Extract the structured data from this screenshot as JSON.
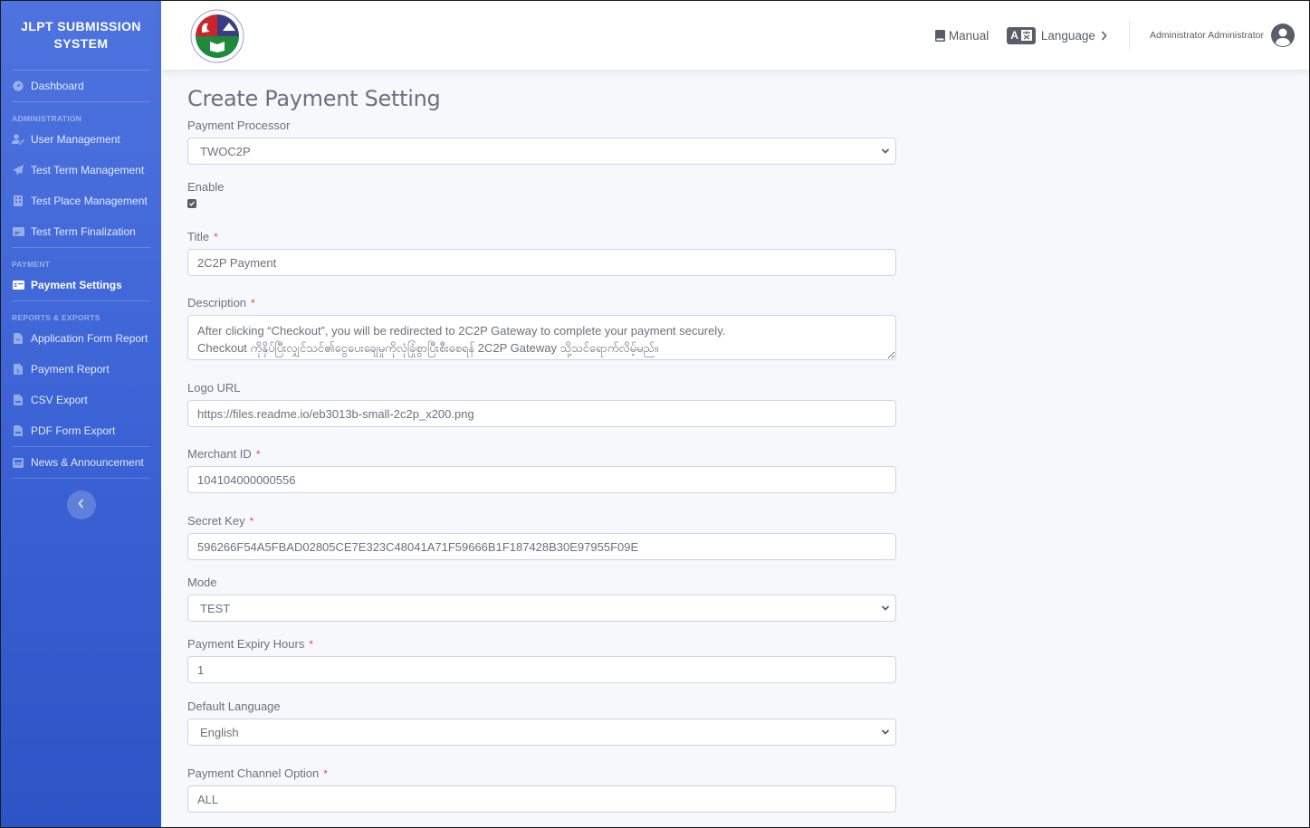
{
  "brand": {
    "line1": "JLPT SUBMISSION",
    "line2": "SYSTEM"
  },
  "sidebar": {
    "dashboard": {
      "label": "Dashboard",
      "icon": "tachometer-icon"
    },
    "sections": [
      {
        "heading": "ADMINISTRATION",
        "items": [
          {
            "label": "User Management",
            "icon": "user-edit-icon"
          },
          {
            "label": "Test Term Management",
            "icon": "paper-plane-icon"
          },
          {
            "label": "Test Place Management",
            "icon": "building-icon"
          },
          {
            "label": "Test Term Finalization",
            "icon": "id-card-icon"
          }
        ]
      },
      {
        "heading": "PAYMENT",
        "items": [
          {
            "label": "Payment Settings",
            "icon": "payment-card-icon",
            "active": true
          }
        ]
      },
      {
        "heading": "REPORTS & EXPORTS",
        "items": [
          {
            "label": "Application Form Report",
            "icon": "file-icon"
          },
          {
            "label": "Payment Report",
            "icon": "file-invoice-dollar-icon"
          },
          {
            "label": "CSV Export",
            "icon": "file-csv-icon"
          },
          {
            "label": "PDF Form Export",
            "icon": "file-pdf-icon"
          }
        ]
      }
    ],
    "news": {
      "label": "News & Announcement",
      "icon": "newspaper-icon"
    },
    "collapse_icon": "chevron-left-icon"
  },
  "topbar": {
    "manual_label": "Manual",
    "language_badge": "A",
    "language_label": "Language",
    "user_name": "Administrator Administrator"
  },
  "page": {
    "title": "Create Payment Setting"
  },
  "form": {
    "payment_processor": {
      "label": "Payment Processor",
      "value": "TWOC2P"
    },
    "enable": {
      "label": "Enable",
      "checked": true
    },
    "title": {
      "label": "Title",
      "required": "*",
      "value": "2C2P Payment"
    },
    "description": {
      "label": "Description",
      "required": "*",
      "value": "After clicking “Checkout”, you will be redirected to 2C2P Gateway to complete your payment securely.\nCheckout ကိုနှိပ်ပြီးလျှင်သင်၏ငွေပေးချေမှုကိုလုံခြုံစွာပြီးစီးစေရန် 2C2P Gateway သို့သင်ရောက်လိမ့်မည်။"
    },
    "logo_url": {
      "label": "Logo URL",
      "value": "https://files.readme.io/eb3013b-small-2c2p_x200.png"
    },
    "merchant_id": {
      "label": "Merchant ID",
      "required": "*",
      "value": "104104000000556"
    },
    "secret_key": {
      "label": "Secret Key",
      "required": "*",
      "value": "596266F54A5FBAD02805CE7E323C48041A71F59666B1F187428B30E97955F09E"
    },
    "mode": {
      "label": "Mode",
      "value": "TEST"
    },
    "payment_expiry_hours": {
      "label": "Payment Expiry Hours",
      "required": "*",
      "value": "1"
    },
    "default_language": {
      "label": "Default Language",
      "value": "English"
    },
    "payment_channel_option": {
      "label": "Payment Channel Option",
      "required": "*",
      "value": "ALL"
    }
  },
  "colors": {
    "sidebar_top": "#4e73df",
    "sidebar_bottom": "#2c54c5",
    "required": "#e74a3b",
    "text_muted": "#6e707e",
    "page_bg": "#f7f8fc"
  }
}
